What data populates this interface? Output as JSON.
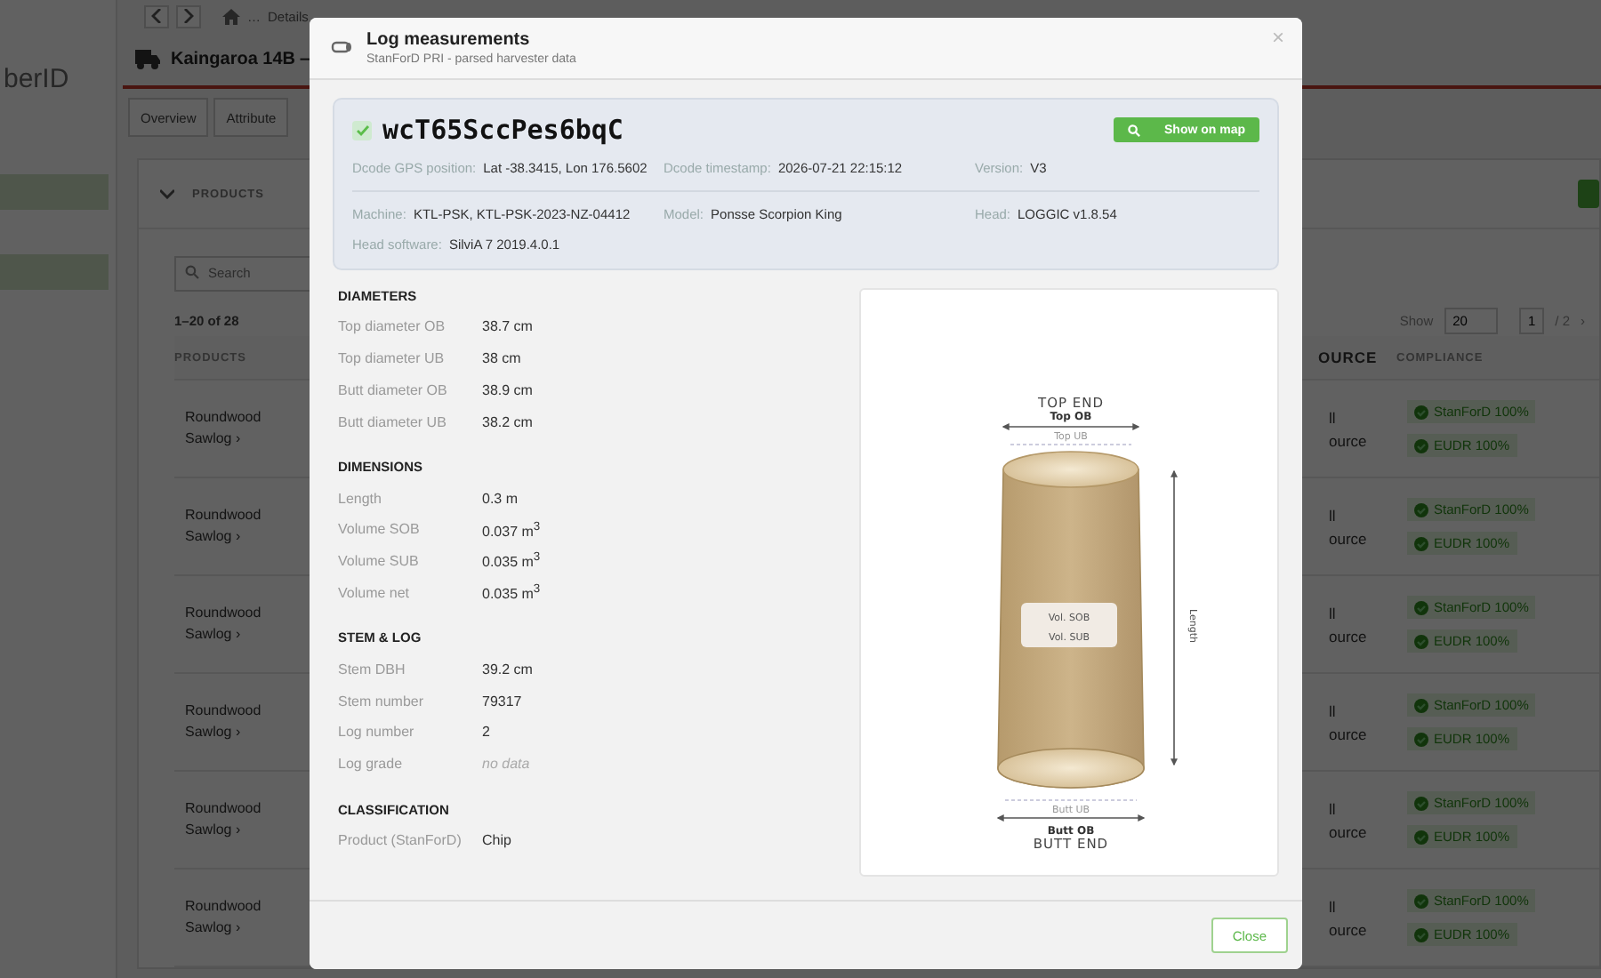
{
  "app": {
    "logo": "berID",
    "breadcrumb": [
      "…",
      "Details"
    ],
    "page_title": "Kaingaroa 14B —",
    "tabs": [
      {
        "label": "Overview"
      },
      {
        "label": "Attribute"
      }
    ],
    "products": {
      "title": "PRODUCTS",
      "search": {
        "placeholder": "Search"
      },
      "count": "1–20 of 28",
      "show_label": "Show",
      "page_size": "20",
      "page": "1",
      "pages": "/ 2",
      "next": "›",
      "columns": [
        "PRODUCTS",
        "OURCE",
        "COMPLIANCE"
      ],
      "rows": [
        {
          "product": "Roundwood Sawlog ›",
          "source": [
            "ll",
            "ource"
          ],
          "compliance": [
            "StanForD 100%",
            "EUDR 100%"
          ]
        },
        {
          "product": "Roundwood Sawlog ›",
          "source": [
            "ll",
            "ource"
          ],
          "compliance": [
            "StanForD 100%",
            "EUDR 100%"
          ]
        },
        {
          "product": "Roundwood Sawlog ›",
          "source": [
            "ll",
            "ource"
          ],
          "compliance": [
            "StanForD 100%",
            "EUDR 100%"
          ]
        },
        {
          "product": "Roundwood Sawlog ›",
          "source": [
            "ll",
            "ource"
          ],
          "compliance": [
            "StanForD 100%",
            "EUDR 100%"
          ]
        },
        {
          "product": "Roundwood Sawlog ›",
          "source": [
            "ll",
            "ource"
          ],
          "compliance": [
            "StanForD 100%",
            "EUDR 100%"
          ]
        },
        {
          "product": "Roundwood Sawlog ›",
          "source": [
            "ll",
            "ource"
          ],
          "compliance": [
            "StanForD 100%",
            "EUDR 100%"
          ]
        }
      ]
    }
  },
  "modal": {
    "title": "Log measurements",
    "subtitle": "StanForD PRI - parsed harvester data",
    "close": "×",
    "dcode": {
      "id": "wcT65SccPes6bqC",
      "verified": true,
      "map_button": "Show on map",
      "fields": [
        {
          "label": "Dcode GPS position:",
          "value": "Lat -38.3415, Lon 176.5602"
        },
        {
          "label": "Dcode timestamp:",
          "value": "2026-07-21 22:15:12"
        },
        {
          "label": "Version:",
          "value": "V3"
        },
        {
          "label": "Machine:",
          "value": "KTL-PSK, KTL-PSK-2023-NZ-04412"
        },
        {
          "label": "Model:",
          "value": "Ponsse Scorpion King"
        },
        {
          "label": "Head:",
          "value": "LOGGIC v1.8.54"
        },
        {
          "label": "Head software:",
          "value": "SilviA 7 2019.4.0.1"
        }
      ]
    },
    "sections": [
      {
        "title": "DIAMETERS",
        "rows": [
          {
            "label": "Top diameter OB",
            "value": "38.7 cm",
            "missing": false
          },
          {
            "label": "Top diameter UB",
            "value": "38 cm",
            "missing": false
          },
          {
            "label": "Butt diameter OB",
            "value": "38.9 cm",
            "missing": false
          },
          {
            "label": "Butt diameter UB",
            "value": "38.2 cm",
            "missing": false
          }
        ]
      },
      {
        "title": "DIMENSIONS",
        "rows": [
          {
            "label": "Length",
            "value": "0.3 m",
            "missing": false
          },
          {
            "label": "Volume SOB",
            "value": "0.037 m$^{3}$",
            "missing": false
          },
          {
            "label": "Volume SUB",
            "value": "0.035 m$^{3}$",
            "missing": false
          },
          {
            "label": "Volume net",
            "value": "0.035 m$^{3}$",
            "missing": false
          }
        ]
      },
      {
        "title": "STEM & LOG",
        "rows": [
          {
            "label": "Stem DBH",
            "value": "39.2 cm",
            "missing": false
          },
          {
            "label": "Stem number",
            "value": "79317",
            "missing": false
          },
          {
            "label": "Log number",
            "value": "2",
            "missing": false
          },
          {
            "label": "Log grade",
            "value": "no data",
            "missing": true
          }
        ]
      },
      {
        "title": "CLASSIFICATION",
        "rows": [
          {
            "label": "Product (StanForD)",
            "value": "Chip",
            "missing": false
          }
        ]
      }
    ],
    "diagram": {
      "top_end": "TOP END",
      "top_ob": "Top OB",
      "top_ub": "Top UB",
      "vol_sob": "Vol. SOB",
      "vol_sub": "Vol. SUB",
      "length": "Length",
      "butt_ub": "Butt UB",
      "butt_ob": "Butt OB",
      "butt_end": "BUTT END"
    },
    "close_button": "Close"
  }
}
